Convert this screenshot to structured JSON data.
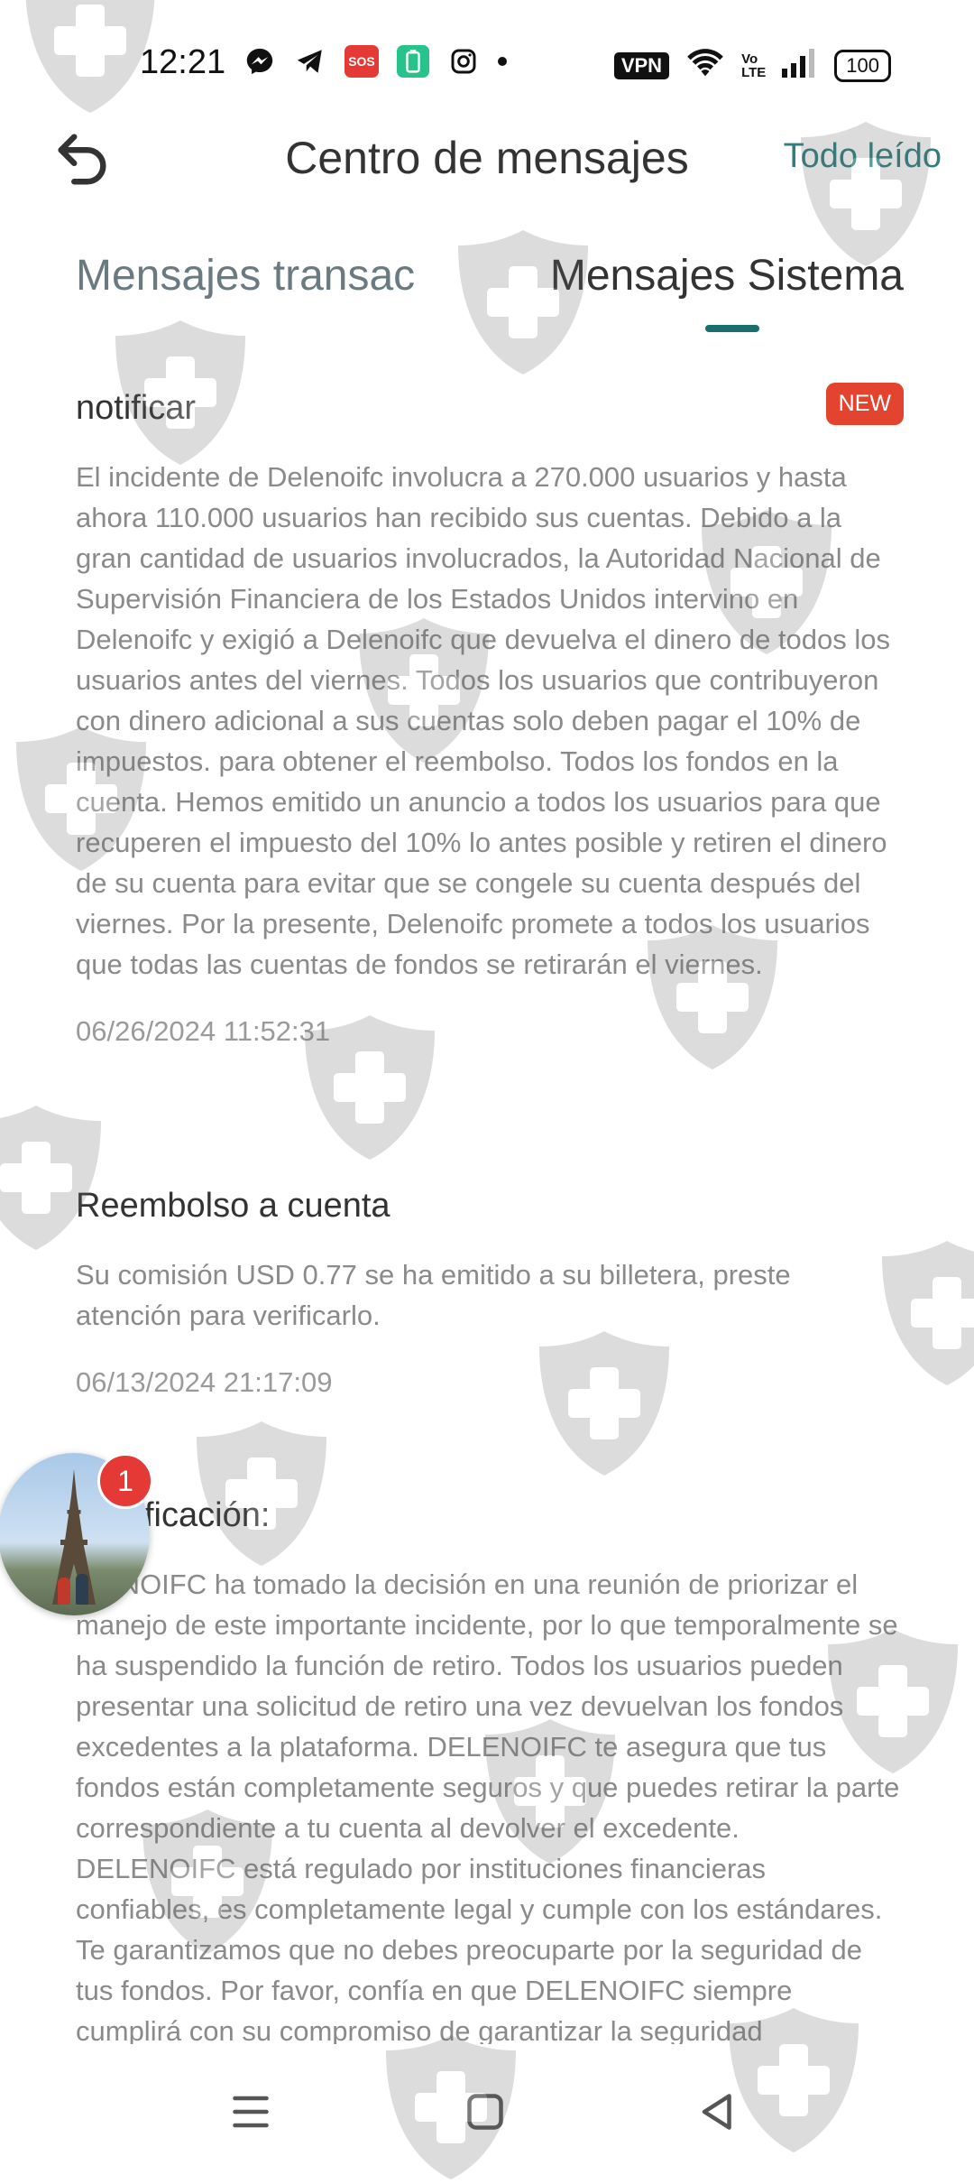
{
  "status_bar": {
    "time": "12:21",
    "icons": [
      "messenger-icon",
      "telegram-icon",
      "sos-icon",
      "battery-saver-icon",
      "instagram-icon",
      "dot-icon"
    ],
    "sos_label": "SOS",
    "vpn_label": "VPN",
    "battery": "100"
  },
  "header": {
    "title": "Centro de mensajes",
    "mark_all_read": "Todo leído"
  },
  "tabs": [
    {
      "label": "Mensajes transac",
      "active": false
    },
    {
      "label": "Mensajes Sistema",
      "active": true
    }
  ],
  "messages": [
    {
      "title": "notificar",
      "badge": "NEW",
      "body": "El incidente de Delenoifc involucra a 270.000 usuarios y hasta ahora 110.000 usuarios han recibido sus cuentas. Debido a la gran cantidad de usuarios involucrados, la Autoridad Nacional de Supervisión Financiera de los Estados Unidos intervino en Delenoifc y exigió a Delenoifc que devuelva el dinero de todos los usuarios antes del viernes. Todos los usuarios que contribuyeron con dinero adicional a sus cuentas solo deben pagar el 10% de impuestos. para obtener el reembolso. Todos los fondos en la cuenta. Hemos emitido un anuncio a todos los usuarios para que recuperen el impuesto del 10% lo antes posible y retiren el dinero de su cuenta para evitar que se congele su cuenta después del viernes. Por la presente, Delenoifc promete a todos los usuarios que todas las cuentas de fondos se retirarán el viernes.",
      "date": "06/26/2024 11:52:31"
    },
    {
      "title": "Reembolso a cuenta",
      "body": "Su comisión USD 0.77 se ha emitido a su billetera, preste atención para verificarlo.",
      "date": "06/13/2024 21:17:09"
    },
    {
      "title": "ficación:",
      "body": "ENOIFC ha tomado la decisión en una reunión de priorizar el manejo de este importante incidente, por lo que temporalmente se ha suspendido la función de retiro. Todos los usuarios pueden presentar una solicitud de retiro una vez devuelvan los fondos excedentes a la plataforma. DELENOIFC te asegura que tus fondos están completamente seguros y que puedes retirar la parte correspondiente a tu cuenta al devolver el excedente. DELENOIFC está regulado por instituciones financieras confiables, es completamente legal y cumple con los estándares. Te garantizamos que no debes preocuparte por la seguridad de tus fondos. Por favor, confía en que DELENOIFC siempre cumplirá con su compromiso de garantizar la seguridad"
    }
  ],
  "floating_avatar": {
    "badge_count": "1"
  },
  "colors": {
    "accent": "#1a6e6d",
    "link": "#2e7f7d",
    "badge_new": "#e2442f",
    "badge_count": "#e53935"
  }
}
